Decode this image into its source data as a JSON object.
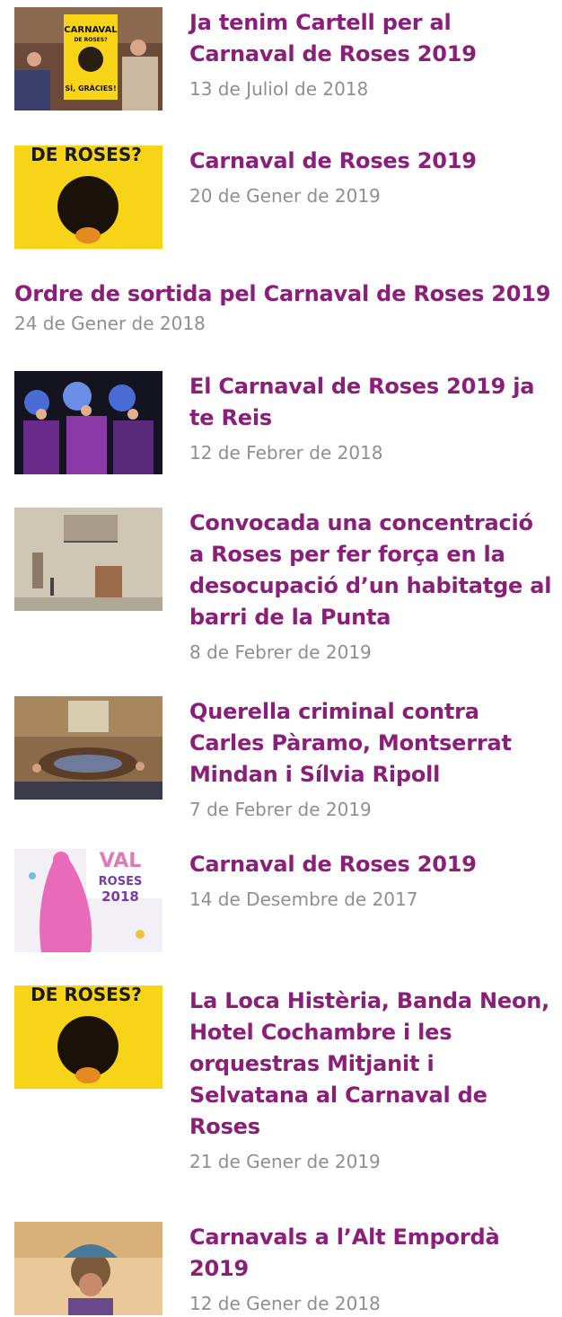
{
  "articles": [
    {
      "title": "Ja tenim Cartell per al Carnaval de Roses 2019",
      "date": "13 de Juliol de 2018",
      "thumb_text": [
        "CARNAVAL",
        "DE ROSES?",
        "SÍ, GRÀCIES!"
      ]
    },
    {
      "title": "Carnaval de Roses 2019",
      "date": "20 de Gener de 2019",
      "thumb_text": [
        "DE ROSES?"
      ]
    },
    {
      "title": "Ordre de sortida pel Carnaval de Roses 2019",
      "date": "24 de Gener de 2018"
    },
    {
      "title": "El Carnaval de Roses 2019 ja te Reis",
      "date": "12 de Febrer de 2018"
    },
    {
      "title": "Convocada una concentració a Roses per fer força en la desocupació d’un habitatge al barri de la Punta",
      "date": "8 de Febrer de 2019"
    },
    {
      "title": "Querella criminal contra Carles Pàramo, Montserrat Mindan i Sílvia Ripoll",
      "date": "7 de Febrer de 2019"
    },
    {
      "title": "Carnaval de Roses 2019",
      "date": "14 de Desembre de 2017",
      "thumb_text": [
        "VAL",
        "ROSES",
        "2018"
      ]
    },
    {
      "title": "La Loca Histèria, Banda Neon, Hotel Cochambre i les orquestras Mitjanit i Selvatana al Carnaval de Roses",
      "date": "21 de Gener de 2019",
      "thumb_text": [
        "DE ROSES?"
      ]
    },
    {
      "title": "Carnavals a l’Alt Empordà 2019",
      "date": "12 de Gener de 2018"
    }
  ],
  "colors": {
    "title": "#8a1f7a",
    "date": "#8f8f8f",
    "poster_yellow": "#f7d417"
  }
}
